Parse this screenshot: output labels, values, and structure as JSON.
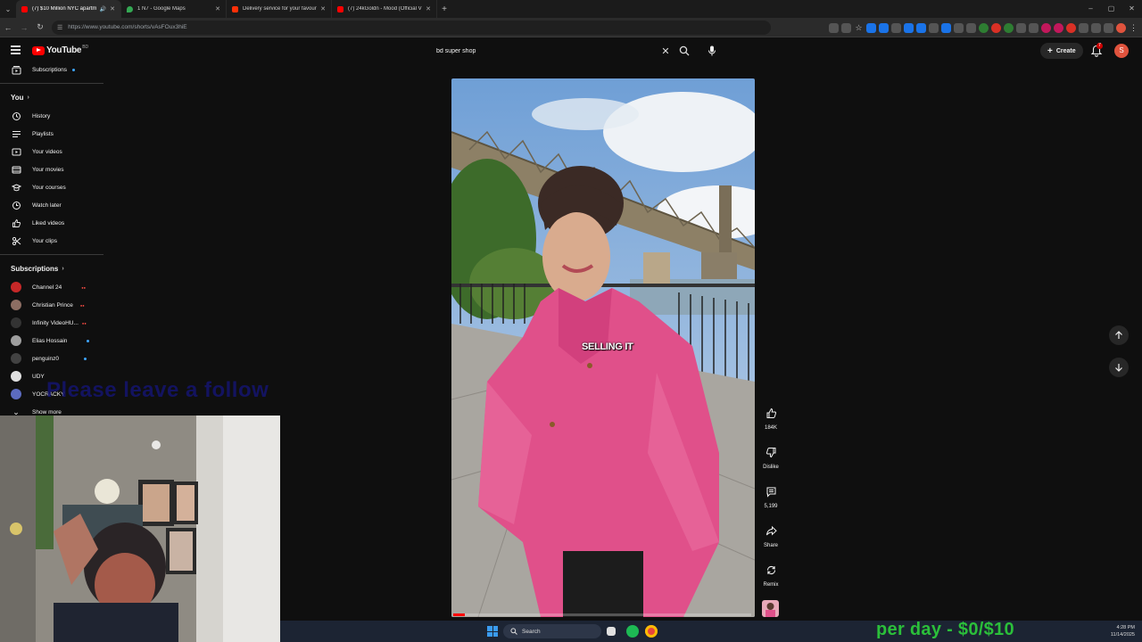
{
  "browser": {
    "tabs": [
      {
        "title": "(7) $10 Million NYC apartm",
        "active": true,
        "favicon_color": "#ff0000",
        "audio": true
      },
      {
        "title": "1 N7 - Google Maps",
        "active": false,
        "favicon_color": "#34a853"
      },
      {
        "title": "Delivery service for your favouri",
        "active": false,
        "favicon_color": "#ff3008"
      },
      {
        "title": "(7) 24kGoldn - Mood (Official V",
        "active": false,
        "favicon_color": "#ff0000"
      }
    ],
    "new_tab": "+",
    "window_controls": [
      "–",
      "▢",
      "✕"
    ],
    "url": "https://www.youtube.com/shorts/vAsFOux3hiE"
  },
  "header": {
    "logo_text": "YouTube",
    "logo_country": "BD",
    "search_value": "bd super shop",
    "create_label": "Create",
    "notification_count": "7",
    "avatar_letter": "S"
  },
  "sidebar": {
    "subscriptions_top": "Subscriptions",
    "you_heading": "You",
    "you_items": [
      {
        "label": "History",
        "icon": "history-icon"
      },
      {
        "label": "Playlists",
        "icon": "playlists-icon"
      },
      {
        "label": "Your videos",
        "icon": "your-videos-icon"
      },
      {
        "label": "Your movies",
        "icon": "movies-icon"
      },
      {
        "label": "Your courses",
        "icon": "courses-icon"
      },
      {
        "label": "Watch later",
        "icon": "watch-later-icon"
      },
      {
        "label": "Liked videos",
        "icon": "liked-videos-icon"
      },
      {
        "label": "Your clips",
        "icon": "clips-icon"
      }
    ],
    "subscriptions_heading": "Subscriptions",
    "channels": [
      {
        "name": "Channel 24",
        "color": "#c62828",
        "badge": "live"
      },
      {
        "name": "Christian Prince",
        "color": "#8d6e63",
        "badge": "live"
      },
      {
        "name": "Infinity VideoHU...",
        "color": "#222222",
        "badge": "live"
      },
      {
        "name": "Elias Hossain",
        "color": "#9e9e9e",
        "badge": "dot"
      },
      {
        "name": "penguinz0",
        "color": "#424242",
        "badge": "dot"
      },
      {
        "name": "UDY",
        "color": "#e0e0e0",
        "badge": ""
      },
      {
        "name": "YOCRACKY",
        "color": "#5c6bc0",
        "badge": ""
      }
    ],
    "show_more": "Show more"
  },
  "overlay": {
    "follow_text": "Please leave a follow",
    "money_text": "per day - $0/$10"
  },
  "video": {
    "caption": "SELLING IT",
    "progress": 0.04
  },
  "actions": {
    "like_count": "184K",
    "dislike_label": "Dislike",
    "comment_count": "5,199",
    "share_label": "Share",
    "remix_label": "Remix"
  },
  "taskbar": {
    "search_label": "Search",
    "time": "4:28 PM",
    "date": "11/14/2025"
  }
}
